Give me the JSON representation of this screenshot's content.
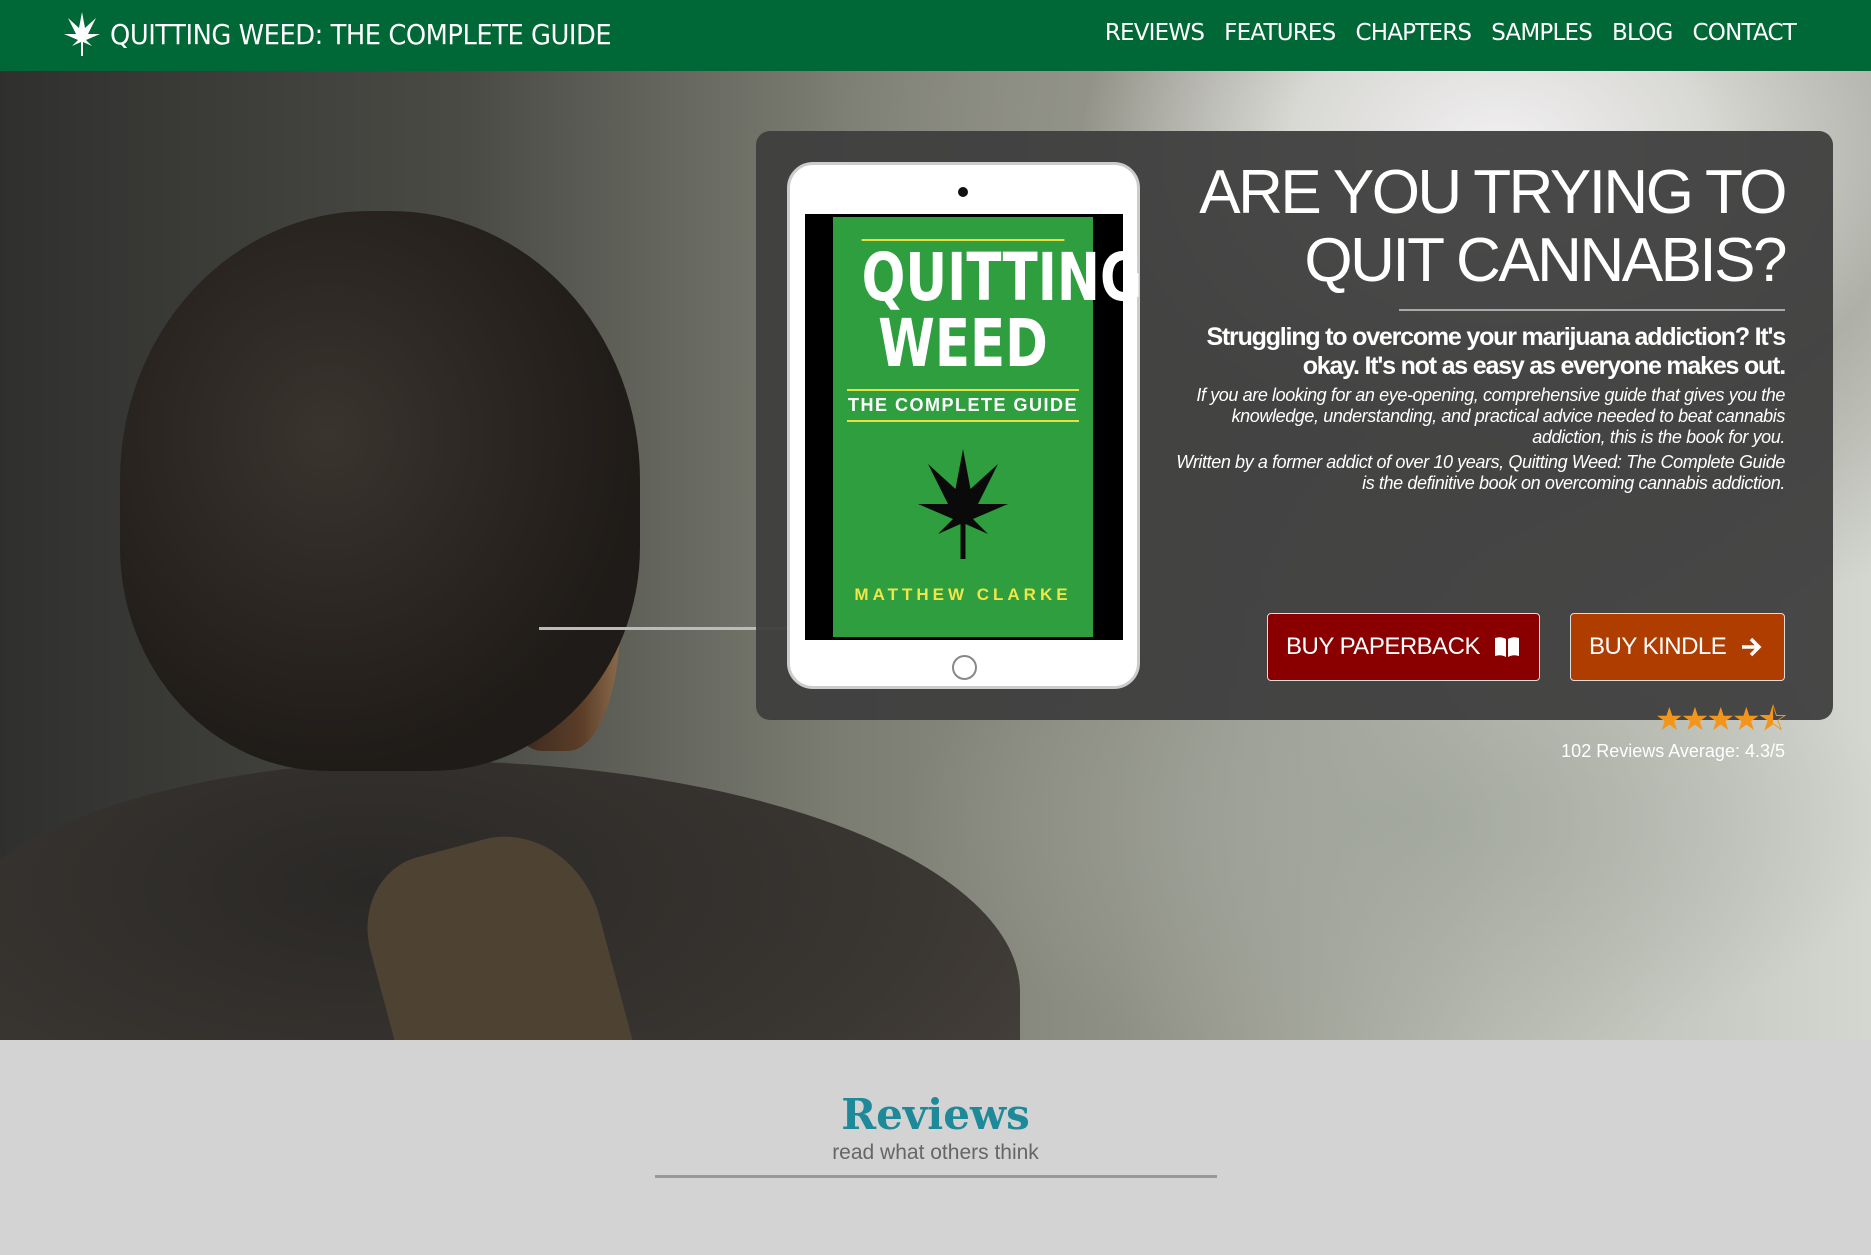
{
  "nav": {
    "brand": "QUITTING WEED: THE COMPLETE GUIDE",
    "items": [
      "REVIEWS",
      "FEATURES",
      "CHAPTERS",
      "SAMPLES",
      "BLOG",
      "CONTACT"
    ]
  },
  "book": {
    "title_line1": "QUITTING",
    "title_line2": "WEED",
    "subtitle": "THE COMPLETE GUIDE",
    "author": "MATTHEW CLARKE"
  },
  "hero": {
    "heading_line1": "ARE YOU TRYING TO",
    "heading_line2": "QUIT CANNABIS?",
    "subheading": "Struggling to overcome your marijuana addiction? It's okay. It's not as easy as everyone makes out.",
    "para1": "If you are looking for an eye-opening, comprehensive guide that gives you the knowledge, understanding, and practical advice needed to beat cannabis addiction, this is the book for you.",
    "para2": "Written by a former addict of over 10 years, Quitting Weed: The Complete Guide is the definitive book on overcoming cannabis addiction.",
    "buy_paperback": "BUY PAPERBACK",
    "buy_kindle": "BUY KINDLE",
    "rating": 4.3,
    "rating_stars": "★★★★⯪",
    "rating_text": "102 Reviews Average: 4.3/5"
  },
  "reviews": {
    "title": "Reviews",
    "subtitle": "read what others think"
  },
  "colors": {
    "nav": "#006837",
    "paperback": "#8a0000",
    "kindle": "#b03d00",
    "reviews_title": "#1e8a99"
  }
}
